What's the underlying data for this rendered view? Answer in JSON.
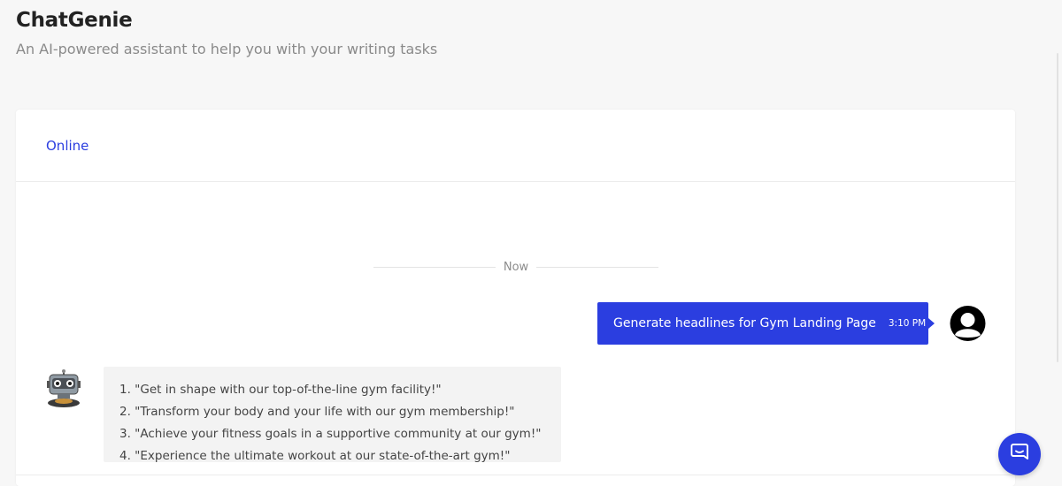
{
  "app": {
    "title": "ChatGenie",
    "subtitle": "An AI-powered assistant to help you with your writing tasks"
  },
  "chat": {
    "status": "Online",
    "divider_label": "Now",
    "messages": [
      {
        "sender": "user",
        "text": "Generate headlines for Gym Landing Page",
        "time": "3:10 PM",
        "avatar_icon": "user-avatar-icon"
      },
      {
        "sender": "bot",
        "avatar_icon": "robot-avatar-icon",
        "lines": [
          "1. \"Get in shape with our top-of-the-line gym facility!\"",
          "2. \"Transform your body and your life with our gym membership!\"",
          "3. \"Achieve your fitness goals in a supportive community at our gym!\"",
          "4. \"Experience the ultimate workout at our state-of-the-art gym!\""
        ]
      }
    ]
  },
  "fab": {
    "icon": "chat-bubble-icon"
  },
  "colors": {
    "accent": "#2b3ee0",
    "page_bg": "#f7f7f7",
    "card_bg": "#ffffff",
    "bot_bubble": "#f3f3f3"
  }
}
